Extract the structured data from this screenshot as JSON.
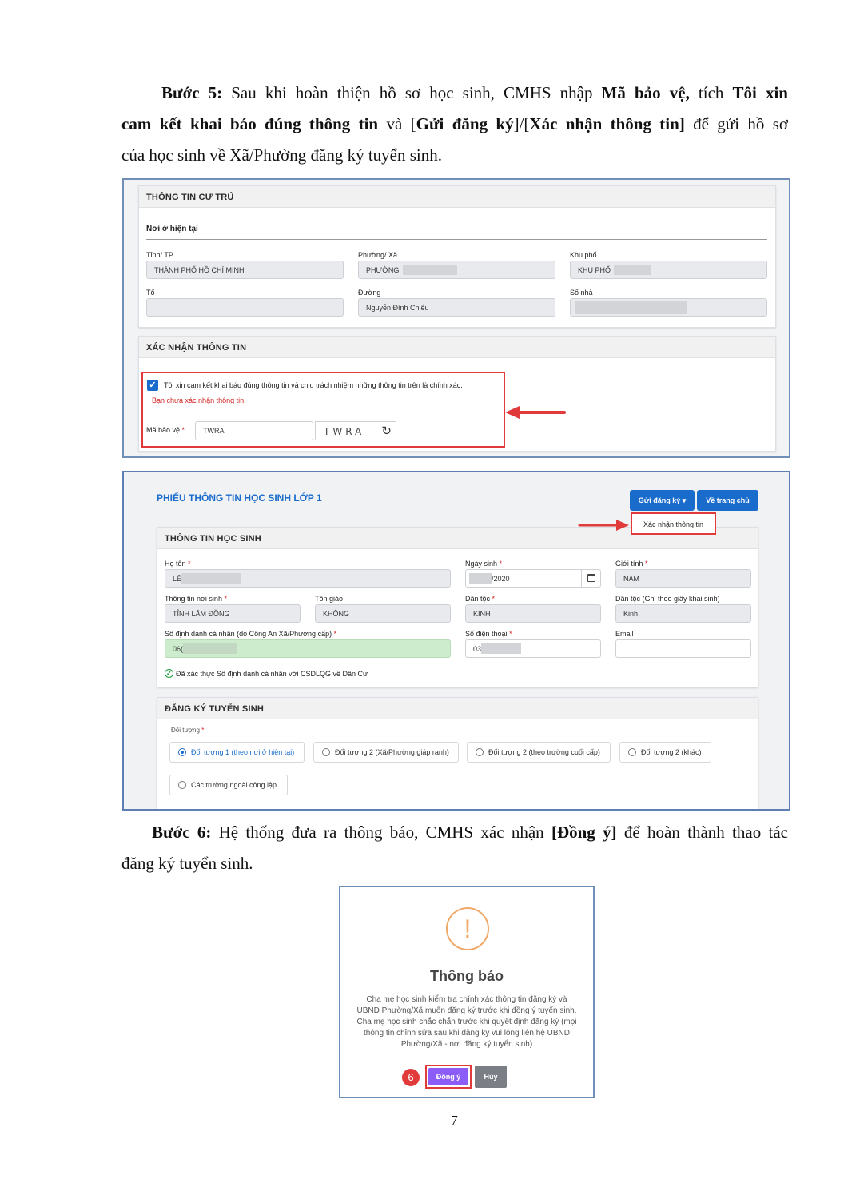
{
  "step5": {
    "label": "Bước 5:",
    "t1": " Sau khi hoàn thiện hồ sơ học sinh, CMHS nhập ",
    "b1": "Mã bảo vệ,",
    "t2": " tích ",
    "b2": "Tôi xin",
    "b3": "cam kết khai báo đúng thông tin",
    "t3": " và [",
    "b4": "Gửi đăng ký",
    "t4": "]/[",
    "b5": "Xác nhận thông tin]",
    "t5": " để gửi hồ sơ",
    "line3": "của học sinh về Xã/Phường đăng ký tuyển sinh."
  },
  "screen1": {
    "residence": {
      "title": "THÔNG TIN CƯ TRÚ",
      "subtitle": "Nơi ở hiện tại",
      "province_label": "Tỉnh/ TP",
      "province_value": "THÀNH PHỐ HỒ CHÍ MINH",
      "ward_label": "Phường/ Xã",
      "ward_value": "PHƯỜNG",
      "quarter_label": "Khu phố",
      "quarter_value": "KHU PHỐ",
      "group_label": "Tổ",
      "group_value": "",
      "street_label": "Đường",
      "street_value": "Nguyễn Đình Chiểu",
      "house_label": "Số nhà",
      "house_value": ""
    },
    "confirm": {
      "title": "XÁC NHẬN THÔNG TIN",
      "checkbox_label": "Tôi xin cam kết khai báo đúng thông tin và chịu trách nhiệm những thông tin trên là chính xác.",
      "error": "Bạn chưa xác nhận thông tin.",
      "captcha_label": "Mã bảo vệ",
      "captcha_value": "TWRA",
      "captcha_image_text": "TWRA"
    }
  },
  "screen2": {
    "title": "PHIẾU THÔNG TIN HỌC SINH LỚP 1",
    "btn_submit": "Gửi đăng ký",
    "btn_home": "Về trang chủ",
    "dropdown_item": "Xác nhận thông tin",
    "student": {
      "title": "THÔNG TIN HỌC SINH",
      "name_label": "Họ tên",
      "name_value": "LÊ",
      "dob_label": "Ngày sinh",
      "dob_value": "/2020",
      "gender_label": "Giới tính",
      "gender_value": "NAM",
      "birthplace_label": "Thông tin nơi sinh",
      "birthplace_value": "TỈNH LÂM ĐỒNG",
      "religion_label": "Tôn giáo",
      "religion_value": "KHÔNG",
      "ethnic_label": "Dân tộc",
      "ethnic_value": "KINH",
      "ethnic2_label": "Dân tộc (Ghi theo giấy khai sinh)",
      "ethnic2_value": "Kinh",
      "id_label": "Số định danh cá nhân (do Công An Xã/Phường cấp)",
      "id_value": "06(",
      "phone_label": "Số điện thoại",
      "phone_value": "03(",
      "email_label": "Email",
      "email_value": "",
      "verified": "Đã xác thực Số định danh cá nhân với CSDLQG về Dân Cư"
    },
    "register": {
      "title": "ĐĂNG KÝ TUYỂN SINH",
      "target_label": "Đối tượng",
      "options": [
        "Đối tượng 1 (theo nơi ở hiện tại)",
        "Đối tượng 2 (Xã/Phường giáp ranh)",
        "Đối tượng 2 (theo trường cuối cấp)",
        "Đối tượng 2 (khác)",
        "Các trường ngoài công lập"
      ],
      "selected": 0
    }
  },
  "step6": {
    "label": "Bước 6:",
    "t1": " Hệ thống đưa ra thông báo, CMHS xác nhận ",
    "b1": "[Đồng ý]",
    "t2": " để hoàn thành thao tác",
    "line2": "đăng ký tuyển sinh."
  },
  "modal": {
    "icon": "!",
    "title": "Thông báo",
    "body": "Cha mẹ học sinh kiểm tra chính xác thông tin đăng ký và UBND Phường/Xã muốn đăng ký trước khi đồng ý tuyển sinh. Cha mẹ học sinh chắc chắn trước khi quyết định đăng ký (mọi thông tin chỉnh sửa sau khi đăng ký vui lòng liên hệ UBND Phường/Xã - nơi đăng ký tuyển sinh)",
    "step_badge": "6",
    "ok": "Đồng ý",
    "cancel": "Hủy"
  },
  "page_number": "7",
  "colors": {
    "primary": "#1a6ccc",
    "highlight": "#e03a3a",
    "modal_ok": "#8b5cf6",
    "warning": "#f0a968",
    "verified": "#1f9d3a"
  }
}
